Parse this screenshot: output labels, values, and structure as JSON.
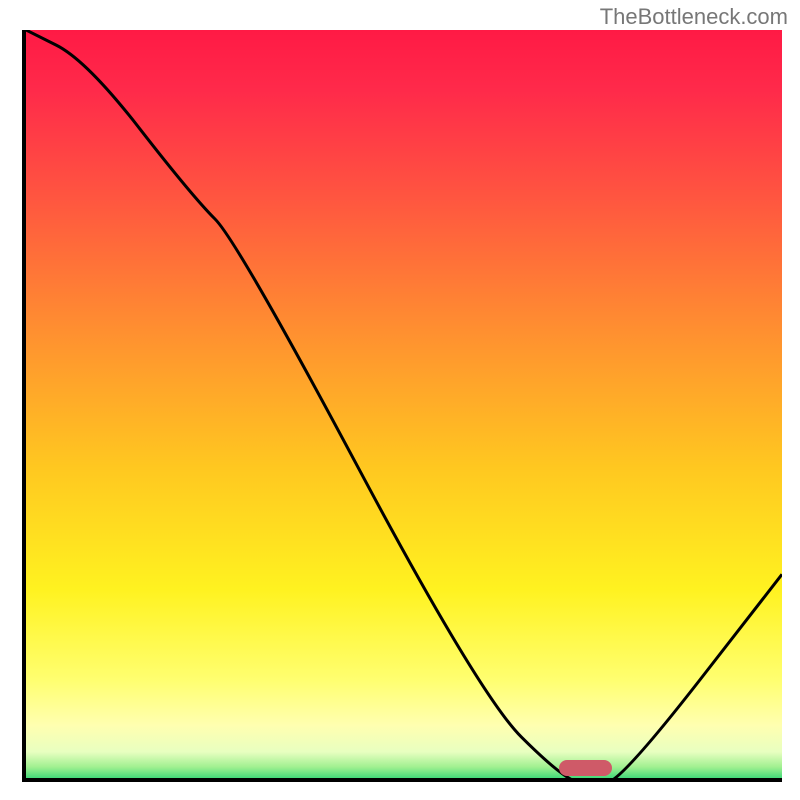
{
  "watermark": "TheBottleneck.com",
  "chart_data": {
    "type": "line",
    "title": "",
    "xlabel": "",
    "ylabel": "",
    "xlim": [
      0,
      100
    ],
    "ylim": [
      0,
      100
    ],
    "series": [
      {
        "name": "curve",
        "x": [
          0,
          8,
          22,
          28,
          60,
          71,
          75,
          79,
          100
        ],
        "values": [
          100,
          96,
          78,
          72,
          12,
          1,
          0,
          1,
          28
        ]
      }
    ],
    "marker": {
      "x_center": 74,
      "y": 0,
      "width_pct": 7
    },
    "gradient_stops": [
      {
        "pos": 0.0,
        "color": "#ff1a45"
      },
      {
        "pos": 0.08,
        "color": "#ff2a4a"
      },
      {
        "pos": 0.22,
        "color": "#ff5540"
      },
      {
        "pos": 0.4,
        "color": "#ff9030"
      },
      {
        "pos": 0.58,
        "color": "#ffc820"
      },
      {
        "pos": 0.74,
        "color": "#fff220"
      },
      {
        "pos": 0.86,
        "color": "#ffff70"
      },
      {
        "pos": 0.92,
        "color": "#ffffb0"
      },
      {
        "pos": 0.955,
        "color": "#e8ffc0"
      },
      {
        "pos": 0.975,
        "color": "#a0f090"
      },
      {
        "pos": 0.99,
        "color": "#40d878"
      },
      {
        "pos": 1.0,
        "color": "#10c868"
      }
    ]
  }
}
